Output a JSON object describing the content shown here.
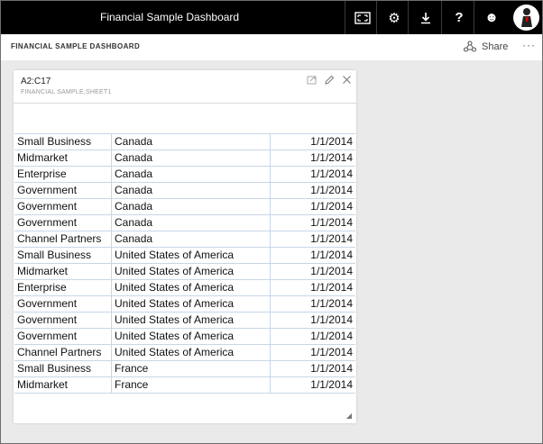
{
  "app": {
    "title": "Financial Sample Dashboard"
  },
  "topbar": {
    "buttons": [
      {
        "name": "fullscreen-button",
        "icon": "fullscreen-icon",
        "glyph": "⛶"
      },
      {
        "name": "settings-button",
        "icon": "gear-icon",
        "glyph": "⚙"
      },
      {
        "name": "download-button",
        "icon": "download-icon",
        "glyph": "⤓"
      },
      {
        "name": "help-button",
        "icon": "help-icon",
        "glyph": "?"
      },
      {
        "name": "feedback-button",
        "icon": "smiley-icon",
        "glyph": "☻"
      }
    ]
  },
  "dashboard": {
    "title": "FINANCIAL SAMPLE DASHBOARD",
    "share_label": "Share",
    "more_label": "···"
  },
  "tile": {
    "title": "A2:C17",
    "subtitle": "FINANCIAL SAMPLE,SHEET1",
    "rows": [
      [
        "Small Business",
        "Canada",
        "1/1/2014"
      ],
      [
        "Midmarket",
        "Canada",
        "1/1/2014"
      ],
      [
        "Enterprise",
        "Canada",
        "1/1/2014"
      ],
      [
        "Government",
        "Canada",
        "1/1/2014"
      ],
      [
        "Government",
        "Canada",
        "1/1/2014"
      ],
      [
        "Government",
        "Canada",
        "1/1/2014"
      ],
      [
        "Channel Partners",
        "Canada",
        "1/1/2014"
      ],
      [
        "Small Business",
        "United States of America",
        "1/1/2014"
      ],
      [
        "Midmarket",
        "United States of America",
        "1/1/2014"
      ],
      [
        "Enterprise",
        "United States of America",
        "1/1/2014"
      ],
      [
        "Government",
        "United States of America",
        "1/1/2014"
      ],
      [
        "Government",
        "United States of America",
        "1/1/2014"
      ],
      [
        "Government",
        "United States of America",
        "1/1/2014"
      ],
      [
        "Channel Partners",
        "United States of America",
        "1/1/2014"
      ],
      [
        "Small Business",
        "France",
        "1/1/2014"
      ],
      [
        "Midmarket",
        "France",
        "1/1/2014"
      ]
    ]
  },
  "colors": {
    "topbar": "#000000",
    "gridline": "#c8d6e8",
    "background": "#eaeaea"
  }
}
